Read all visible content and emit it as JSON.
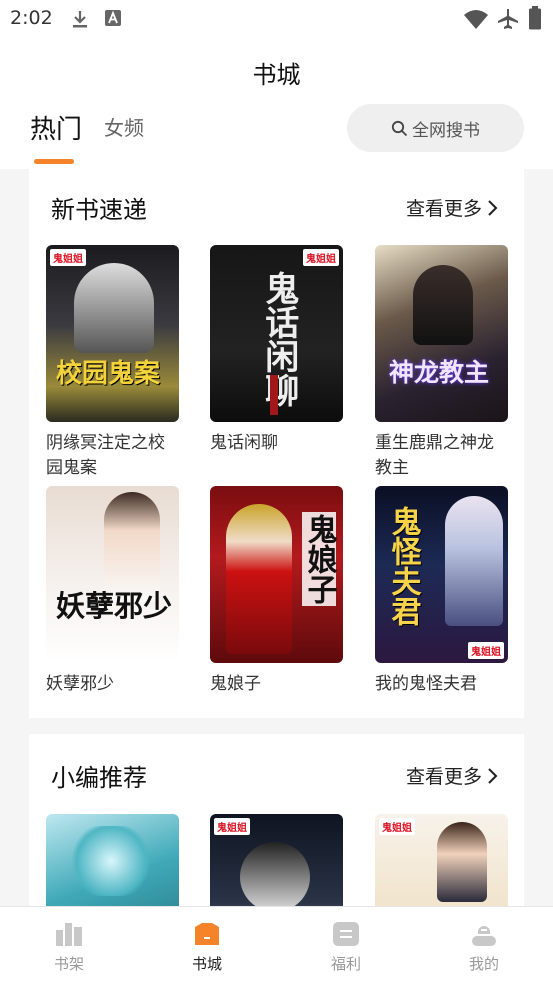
{
  "status_bar": {
    "time": "2:02"
  },
  "header": {
    "title": "书城",
    "tabs": [
      {
        "label": "热门",
        "active": true
      },
      {
        "label": "女频",
        "active": false
      }
    ],
    "search_label": "全网搜书"
  },
  "sections": [
    {
      "title": "新书速递",
      "more": "查看更多",
      "books": [
        {
          "title": "阴缘冥注定之校园鬼案"
        },
        {
          "title": "鬼话闲聊"
        },
        {
          "title": "重生鹿鼎之神龙教主"
        },
        {
          "title": "妖孽邪少"
        },
        {
          "title": "鬼娘子"
        },
        {
          "title": "我的鬼怪夫君"
        }
      ]
    },
    {
      "title": "小编推荐",
      "more": "查看更多"
    }
  ],
  "covers": {
    "c1": {
      "text": "校园鬼案",
      "brand": "鬼姐姐"
    },
    "c2": {
      "text": "鬼话闲聊",
      "brand": "鬼姐姐"
    },
    "c3": {
      "text": "神龙教主"
    },
    "c4": {
      "text": "妖孽邪少"
    },
    "c5": {
      "text": "鬼娘子"
    },
    "c6": {
      "text": "鬼怪夫君",
      "brand": "鬼姐姐"
    },
    "c7": {},
    "c8": {
      "brand": "鬼姐姐"
    },
    "c9": {
      "brand": "鬼姐姐"
    }
  },
  "bottom_nav": [
    {
      "label": "书架",
      "icon": "bookshelf-icon",
      "active": false
    },
    {
      "label": "书城",
      "icon": "bookstore-icon",
      "active": true
    },
    {
      "label": "福利",
      "icon": "welfare-icon",
      "active": false
    },
    {
      "label": "我的",
      "icon": "profile-icon",
      "active": false
    }
  ],
  "colors": {
    "accent": "#f5832a",
    "background": "#f5f5f5",
    "inactive": "#999999"
  }
}
